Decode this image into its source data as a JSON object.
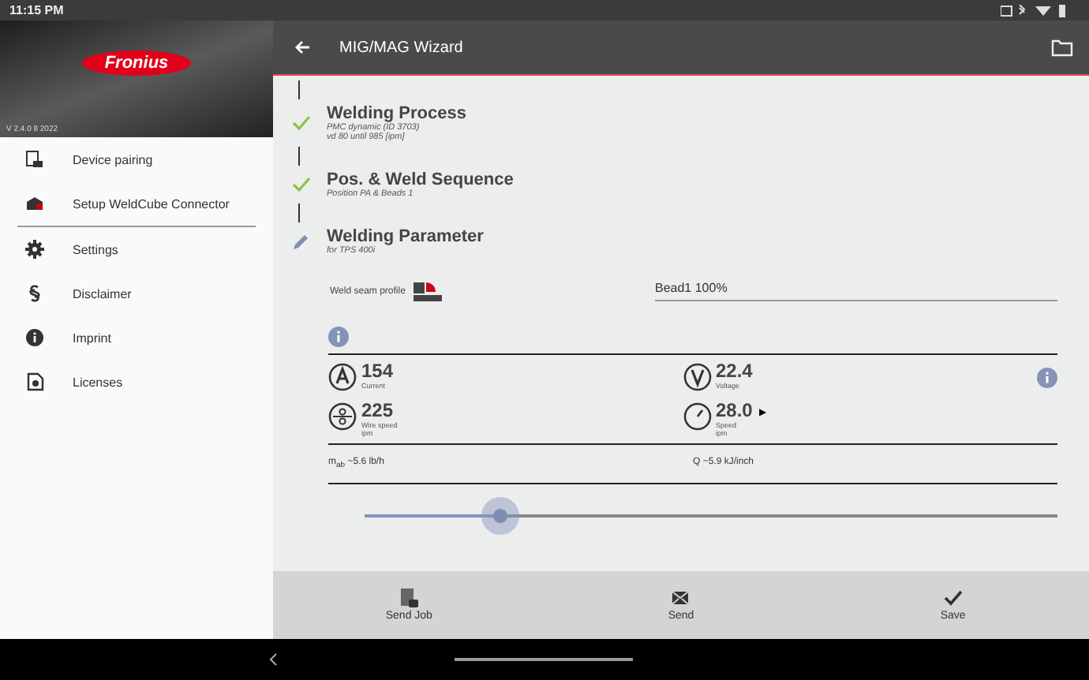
{
  "status_bar": {
    "time": "11:15 PM"
  },
  "drawer": {
    "logo": "Fronius",
    "version": "V 2.4.0 8 2022",
    "items": [
      {
        "label": "Device pairing",
        "kind": "device"
      },
      {
        "label": "Setup WeldCube Connector",
        "kind": "cube"
      },
      {
        "label": "Settings",
        "kind": "gear"
      },
      {
        "label": "Disclaimer",
        "kind": "section"
      },
      {
        "label": "Imprint",
        "kind": "info"
      },
      {
        "label": "Licenses",
        "kind": "license"
      }
    ]
  },
  "app_bar": {
    "title": "MIG/MAG Wizard"
  },
  "steps": [
    {
      "kind": "done",
      "title": "Welding Process",
      "lines": [
        "PMC dynamic (ID 3703)",
        "vd 80 until 985 [ipm]"
      ]
    },
    {
      "kind": "done",
      "title": "Pos. & Weld Sequence",
      "lines": [
        "Position PA & Beads 1"
      ]
    },
    {
      "kind": "current",
      "title": "Welding Parameter",
      "lines": [
        "for TPS 400i"
      ]
    }
  ],
  "seam": {
    "label": "Weld seam profile",
    "value": "Bead1 100%"
  },
  "params": [
    {
      "kind": "current",
      "value": "154",
      "labels": [
        "Current"
      ]
    },
    {
      "kind": "voltage",
      "value": "22.4",
      "labels": [
        "Voltage"
      ]
    },
    {
      "kind": "wire",
      "value": "225",
      "labels": [
        "Wire speed",
        "ipm"
      ]
    },
    {
      "kind": "speed",
      "value": "28.0",
      "marker": "▶",
      "labels": [
        "Speed",
        "ipm"
      ]
    }
  ],
  "results": [
    "m$_{ab}$ ~5.6 lb/h",
    "Q ~5.9 kJ/inch"
  ],
  "slider": {
    "level": 0.195
  },
  "actions": [
    {
      "kind": "job",
      "label": "Send Job"
    },
    {
      "kind": "mail",
      "label": "Send"
    },
    {
      "kind": "check",
      "label": "Save"
    }
  ]
}
